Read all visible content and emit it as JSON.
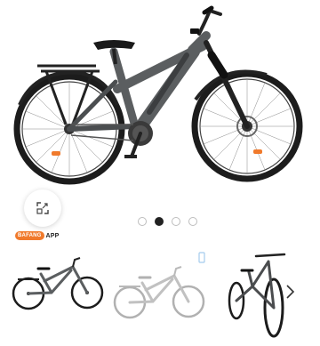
{
  "app_badge": {
    "brand": "BAFANG",
    "label": "APP"
  },
  "carousel": {
    "slide_count": 4,
    "active_index": 1
  },
  "icons": {
    "expand": "expand-icon",
    "next": "chevron-right-icon"
  },
  "colors": {
    "frame": "#5b5e60",
    "accent": "#f07a2c",
    "dot_active": "#222222",
    "dot_inactive": "#bdbdbd"
  }
}
